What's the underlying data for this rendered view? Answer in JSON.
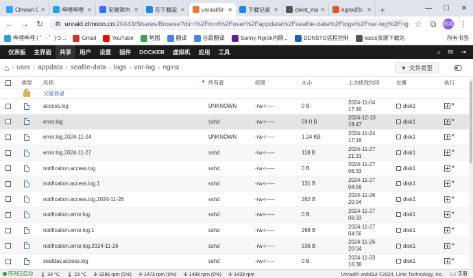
{
  "browser": {
    "tabs": [
      {
        "title": "Clmoon C",
        "color": "#3aa0ff",
        "active": false
      },
      {
        "title": "哔哩哔哩（",
        "color": "#20a4e8",
        "active": false
      },
      {
        "title": "安徽滁州",
        "color": "#2f70ff",
        "active": false
      },
      {
        "title": "在下载超",
        "color": "#1e88e5",
        "active": false
      },
      {
        "title": "unraid/Br",
        "color": "#f07a2a",
        "active": true
      },
      {
        "title": "下载记录",
        "color": "#1e88e5",
        "active": false
      },
      {
        "title": "client_ma",
        "color": "#555",
        "active": false
      },
      {
        "title": "nginx的c",
        "color": "#e5532d",
        "active": false
      }
    ],
    "new_tab": "+",
    "address": {
      "host": "unraid.clmoon.cn",
      "path": ":20443/Shares/Browse?dir=%2Fmnt%2Fuser%2Fappdata%2Fseafile-data%2Flogs%2Fvar-log%2Fnginx"
    },
    "profile_initials": "伍兆",
    "bookmarks": [
      {
        "label": "哔哩哔哩 ( ゜- ゜)つ...",
        "color": "#20a4e8"
      },
      {
        "label": "Gmail",
        "color": "#d93025"
      },
      {
        "label": "YouTube",
        "color": "#ff0000"
      },
      {
        "label": "地图",
        "color": "#34a853"
      },
      {
        "label": "翻译",
        "color": "#4285f4"
      },
      {
        "label": "谷歌翻译",
        "color": "#4285f4"
      },
      {
        "label": "Sunny-Ngrok内网...",
        "color": "#6a1b9a"
      },
      {
        "label": "DDNSTO远程控制",
        "color": "#1565c0"
      },
      {
        "label": "kaios资源下载站",
        "color": "#555"
      }
    ],
    "bookmarks_right": "所有书签"
  },
  "unraid_nav": {
    "items": [
      "仪表板",
      "主界面",
      "共享",
      "用户",
      "设置",
      "插件",
      "DOCKER",
      "虚拟机",
      "应用",
      "工具"
    ],
    "active_index": 2
  },
  "breadcrumb": {
    "parts": [
      "user",
      "appdata",
      "seafile-data",
      "logs",
      "var-log",
      "nginx"
    ],
    "filter_label": "文件类型"
  },
  "table": {
    "headers": {
      "type": "类型",
      "name": "名称",
      "owner": "所有者",
      "perm": "权限",
      "size": "大小",
      "modified": "上次修改时间",
      "location": "位置",
      "actions": "执行"
    },
    "parent_label": "父级目录",
    "rows": [
      {
        "name": "access.log",
        "owner": "UNKNOWN",
        "perm": "-rw-r-----",
        "size": "0 B",
        "date": "2024-11-04",
        "time": "17:46",
        "loc": "disk1"
      },
      {
        "name": "error.log",
        "owner": "sshd",
        "perm": "-rw-r-----",
        "size": "59.0 B",
        "date": "2024-12-10",
        "time": "19:47",
        "loc": "disk1",
        "selected": true
      },
      {
        "name": "error.log.2024-11-24",
        "owner": "UNKNOWN",
        "perm": "-rw-r-----",
        "size": "1.24 KB",
        "date": "2024-11-24",
        "time": "17:16",
        "loc": "disk1"
      },
      {
        "name": "error.log.2024-11-27",
        "owner": "sshd",
        "perm": "-rw-r-----",
        "size": "118 B",
        "date": "2024-11-27",
        "time": "21:31",
        "loc": "disk1"
      },
      {
        "name": "notification.access.log",
        "owner": "sshd",
        "perm": "-rw-r-----",
        "size": "0 B",
        "date": "2024-11-27",
        "time": "06:33",
        "loc": "disk1"
      },
      {
        "name": "notification.access.log.1",
        "owner": "sshd",
        "perm": "-rw-r-----",
        "size": "131 B",
        "date": "2024-11-27",
        "time": "04:56",
        "loc": "disk1"
      },
      {
        "name": "notification.access.log.2024-11-26",
        "owner": "sshd",
        "perm": "-rw-r-----",
        "size": "262 B",
        "date": "2024-11-26",
        "time": "20:04",
        "loc": "disk1"
      },
      {
        "name": "notification.error.log",
        "owner": "sshd",
        "perm": "-rw-r-----",
        "size": "0 B",
        "date": "2024-11-27",
        "time": "06:33",
        "loc": "disk1"
      },
      {
        "name": "notification.error.log.1",
        "owner": "sshd",
        "perm": "-rw-r-----",
        "size": "268 B",
        "date": "2024-11-27",
        "time": "04:56",
        "loc": "disk1"
      },
      {
        "name": "notification.error.log.2024-11-26",
        "owner": "sshd",
        "perm": "-rw-r-----",
        "size": "536 B",
        "date": "2024-11-26",
        "time": "20:04",
        "loc": "disk1"
      },
      {
        "name": "seafdav.access.log",
        "owner": "sshd",
        "perm": "-rw-r-----",
        "size": "0 B",
        "date": "2024-11-23",
        "time": "16:38",
        "loc": "disk1"
      }
    ]
  },
  "status": {
    "array": "阵列已启动",
    "cpu_temp": "34 °C",
    "mb_temp": "23 °C",
    "fan1": "3286 rpm (0%)",
    "fan2": "1473 rpm (0%)",
    "fan3": "1498 rpm (0%)",
    "fan4": "1439 rpm",
    "copyright": "Unraid® webGui ©2024, Lime Technology, Inc.",
    "manual": "手册"
  }
}
